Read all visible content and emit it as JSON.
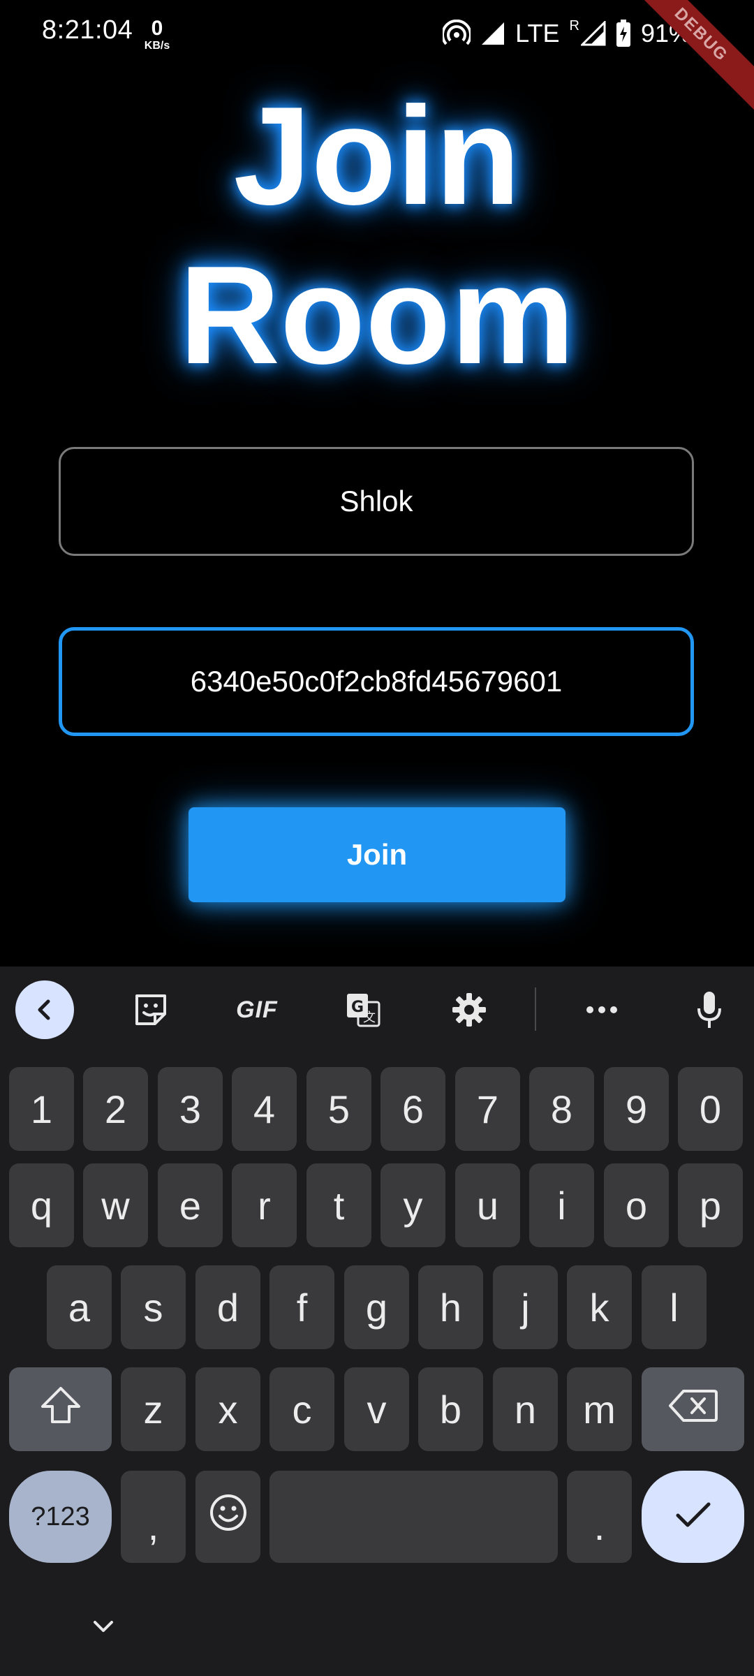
{
  "status_bar": {
    "time": "8:21:04",
    "net_speed_value": "0",
    "net_speed_unit": "KB/s",
    "network": "LTE",
    "roaming": "R",
    "battery": "91%",
    "debug_banner": "DEBUG"
  },
  "page": {
    "title_line1": "Join",
    "title_line2": "Room",
    "name_value": "Shlok",
    "room_id_value": "6340e50c0f2cb8fd45679601",
    "join_label": "Join",
    "accent_color": "#2196f3"
  },
  "keyboard": {
    "toolbar": {
      "gif_label": "GIF",
      "icons": [
        "back-icon",
        "sticker-icon",
        "gif-icon",
        "translate-icon",
        "gear-icon",
        "more-icon",
        "microphone-icon"
      ]
    },
    "row_numbers": [
      "1",
      "2",
      "3",
      "4",
      "5",
      "6",
      "7",
      "8",
      "9",
      "0"
    ],
    "row1": [
      "q",
      "w",
      "e",
      "r",
      "t",
      "y",
      "u",
      "i",
      "o",
      "p"
    ],
    "row2": [
      "a",
      "s",
      "d",
      "f",
      "g",
      "h",
      "j",
      "k",
      "l"
    ],
    "row3": [
      "z",
      "x",
      "c",
      "v",
      "b",
      "n",
      "m"
    ],
    "symbols_label": "?123",
    "comma": ",",
    "period": "."
  }
}
